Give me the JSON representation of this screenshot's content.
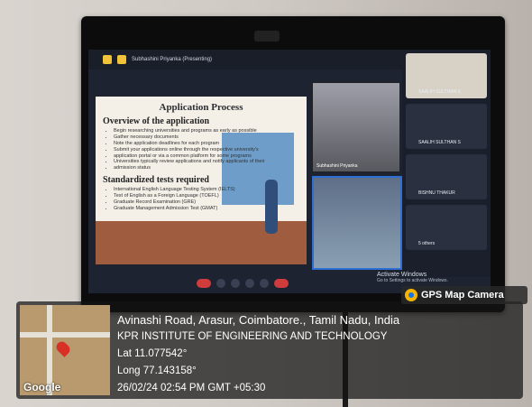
{
  "meeting": {
    "presenter_status": "Subhashini Priyanka (Presenting)"
  },
  "slide": {
    "title": "Application Process",
    "section1": "Overview of the application",
    "bullets": [
      "Begin researching universities and programs as early as possible",
      "Gather necessary documents",
      "Note the application deadlines for each program",
      "Submit your applications online through the respective university's",
      "application portal or via a common platform for some programs",
      "Universities typically review applications and notify applicants of their",
      "admission status"
    ],
    "section2": "Standardized tests required",
    "tests": [
      "International English Language Testing System (IELTS)",
      "Test of English as a Foreign Language (TOEFL)",
      "Graduate Record Examination (GRE)",
      "Graduate Management Admission Test (GMAT)"
    ]
  },
  "participants": [
    {
      "name": "SAALIH SULTHAN S"
    },
    {
      "name": "SAALIH SULTHAN S"
    },
    {
      "name": "BISHNU THAKUR"
    },
    {
      "name": "5 others"
    }
  ],
  "video_tiles": [
    {
      "name": "Subhashini Priyanka"
    },
    {
      "name": ""
    }
  ],
  "windows_notice": {
    "title": "Activate Windows",
    "subtitle": "Go to Settings to activate Windows."
  },
  "gps": {
    "badge": "GPS Map Camera",
    "address": "Avinashi Road, Arasur, Coimbatore., Tamil Nadu, India",
    "place": "KPR INSTITUTE OF ENGINEERING AND TECHNOLOGY",
    "lat": "Lat 11.077542°",
    "long": "Long 77.143158°",
    "datetime": "26/02/24 02:54 PM GMT +05:30",
    "map_label": "Google"
  }
}
